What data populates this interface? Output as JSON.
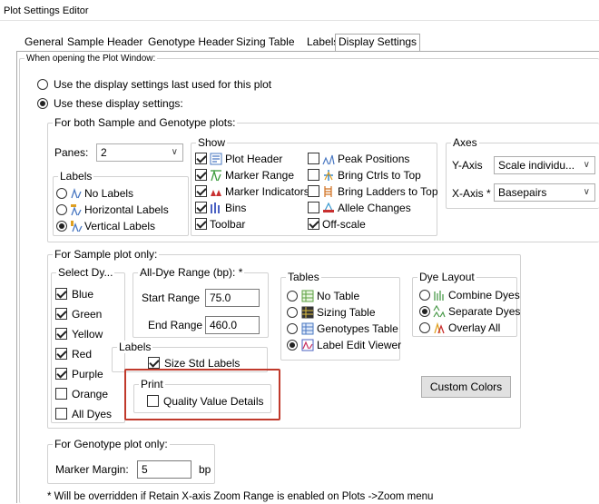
{
  "window": {
    "title": "Plot Settings Editor"
  },
  "tabs": [
    "General",
    "Sample Header",
    "Genotype Header",
    "Sizing Table",
    "Labels",
    "Display Settings"
  ],
  "when_opening": {
    "legend": "When opening the Plot Window:",
    "opt_last": "Use the display settings last used for this plot",
    "opt_these": "Use these display settings:",
    "selected": "these"
  },
  "both": {
    "legend": "For both Sample and Genotype plots:",
    "panes_label": "Panes:",
    "panes_value": "2",
    "labels_legend": "Labels",
    "labels": [
      "No Labels",
      "Horizontal Labels",
      "Vertical Labels"
    ],
    "labels_selected": 2,
    "show_legend": "Show",
    "show_left": [
      {
        "label": "Plot Header",
        "checked": true
      },
      {
        "label": "Marker Range",
        "checked": true
      },
      {
        "label": "Marker Indicators",
        "checked": true
      },
      {
        "label": "Bins",
        "checked": true
      },
      {
        "label": "Toolbar",
        "checked": true
      }
    ],
    "show_right": [
      {
        "label": "Peak Positions",
        "checked": false
      },
      {
        "label": "Bring Ctrls to Top",
        "checked": false
      },
      {
        "label": "Bring Ladders to Top",
        "checked": false
      },
      {
        "label": "Allele Changes",
        "checked": false
      },
      {
        "label": "Off-scale",
        "checked": true
      }
    ],
    "axes_legend": "Axes",
    "yaxis_label": "Y-Axis",
    "yaxis_value": "Scale individu...",
    "xaxis_label": "X-Axis *",
    "xaxis_value": "Basepairs"
  },
  "sample": {
    "legend": "For Sample plot only:",
    "dyes_legend": "Select Dy...",
    "dyes": [
      {
        "label": "Blue",
        "checked": true
      },
      {
        "label": "Green",
        "checked": true
      },
      {
        "label": "Yellow",
        "checked": true
      },
      {
        "label": "Red",
        "checked": true
      },
      {
        "label": "Purple",
        "checked": true
      },
      {
        "label": "Orange",
        "checked": false
      },
      {
        "label": "All Dyes",
        "checked": false
      }
    ],
    "range_legend": "All-Dye Range (bp): *",
    "start_label": "Start Range",
    "start_value": "75.0",
    "end_label": "End Range",
    "end_value": "460.0",
    "labels_legend": "Labels",
    "size_std": {
      "label": "Size Std Labels",
      "checked": true
    },
    "print_legend": "Print",
    "quality": {
      "label": "Quality Value Details",
      "checked": false
    },
    "tables_legend": "Tables",
    "tables": [
      "No Table",
      "Sizing Table",
      "Genotypes Table",
      "Label Edit Viewer"
    ],
    "tables_selected": 3,
    "dye_layout_legend": "Dye Layout",
    "dye_layout": [
      "Combine Dyes",
      "Separate Dyes",
      "Overlay All"
    ],
    "dye_layout_selected": 1,
    "custom_colors": "Custom Colors"
  },
  "genotype": {
    "legend": "For Genotype plot only:",
    "marker_margin_label": "Marker Margin:",
    "marker_margin_value": "5",
    "unit": "bp"
  },
  "footnote": "* Will be overridden if Retain X-axis Zoom Range is enabled on Plots ->Zoom menu",
  "colors": {
    "highlight": "#c0392b"
  }
}
